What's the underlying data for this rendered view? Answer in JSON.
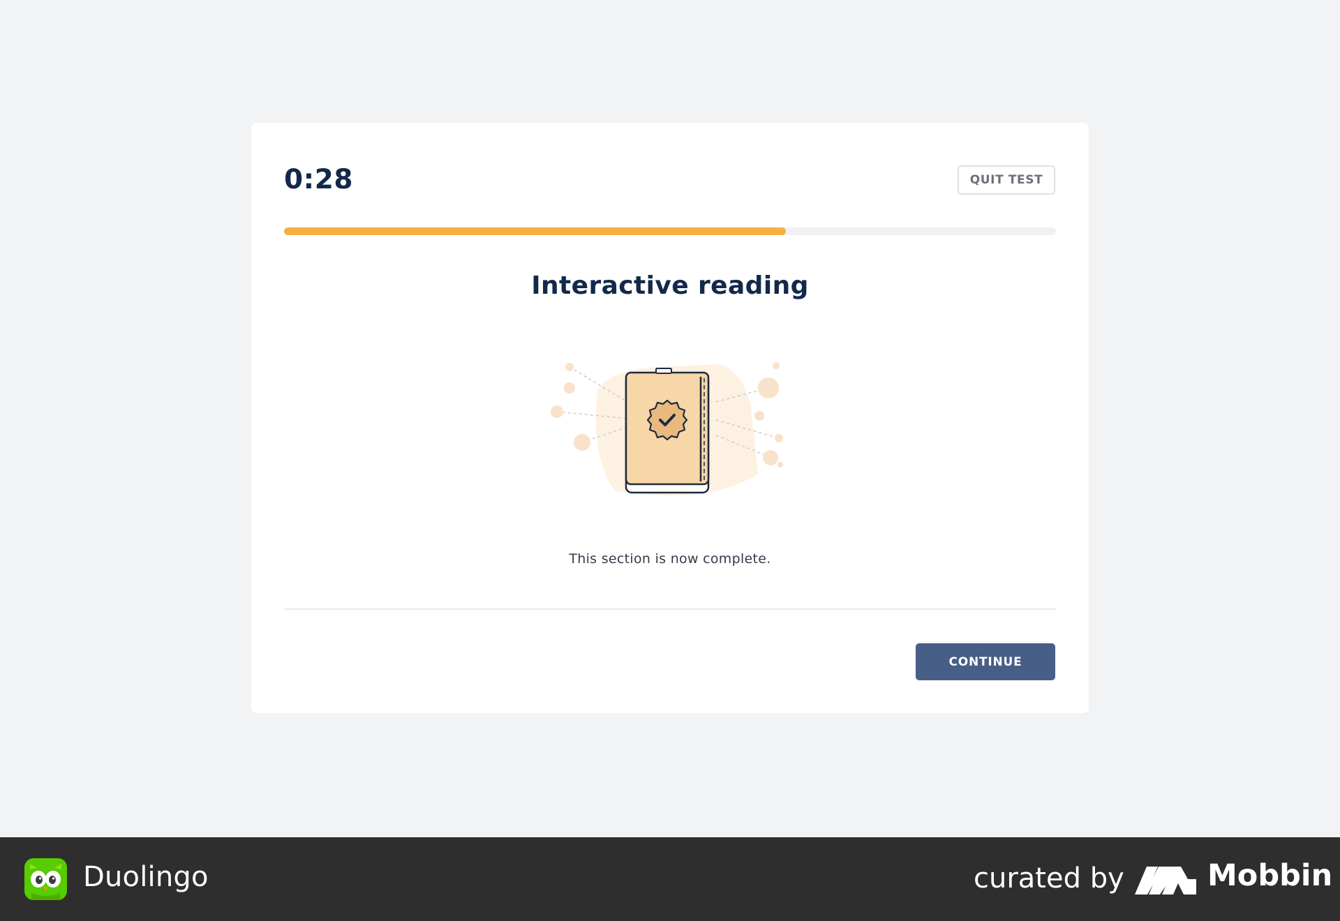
{
  "test": {
    "timer": "0:28",
    "quit_label": "QUIT TEST",
    "progress_percent": 65
  },
  "section": {
    "title": "Interactive reading",
    "status": "This section is now complete.",
    "illustration_icon": "book-with-check-badge-icon"
  },
  "actions": {
    "continue_label": "CONTINUE"
  },
  "footer": {
    "app_name": "Duolingo",
    "curated_label": "curated by",
    "brand_name": "Mobbin"
  },
  "colors": {
    "accent": "#f4b13f",
    "primary_button": "#475e86",
    "heading": "#13294b",
    "footer_bg": "#2e2e2e"
  }
}
